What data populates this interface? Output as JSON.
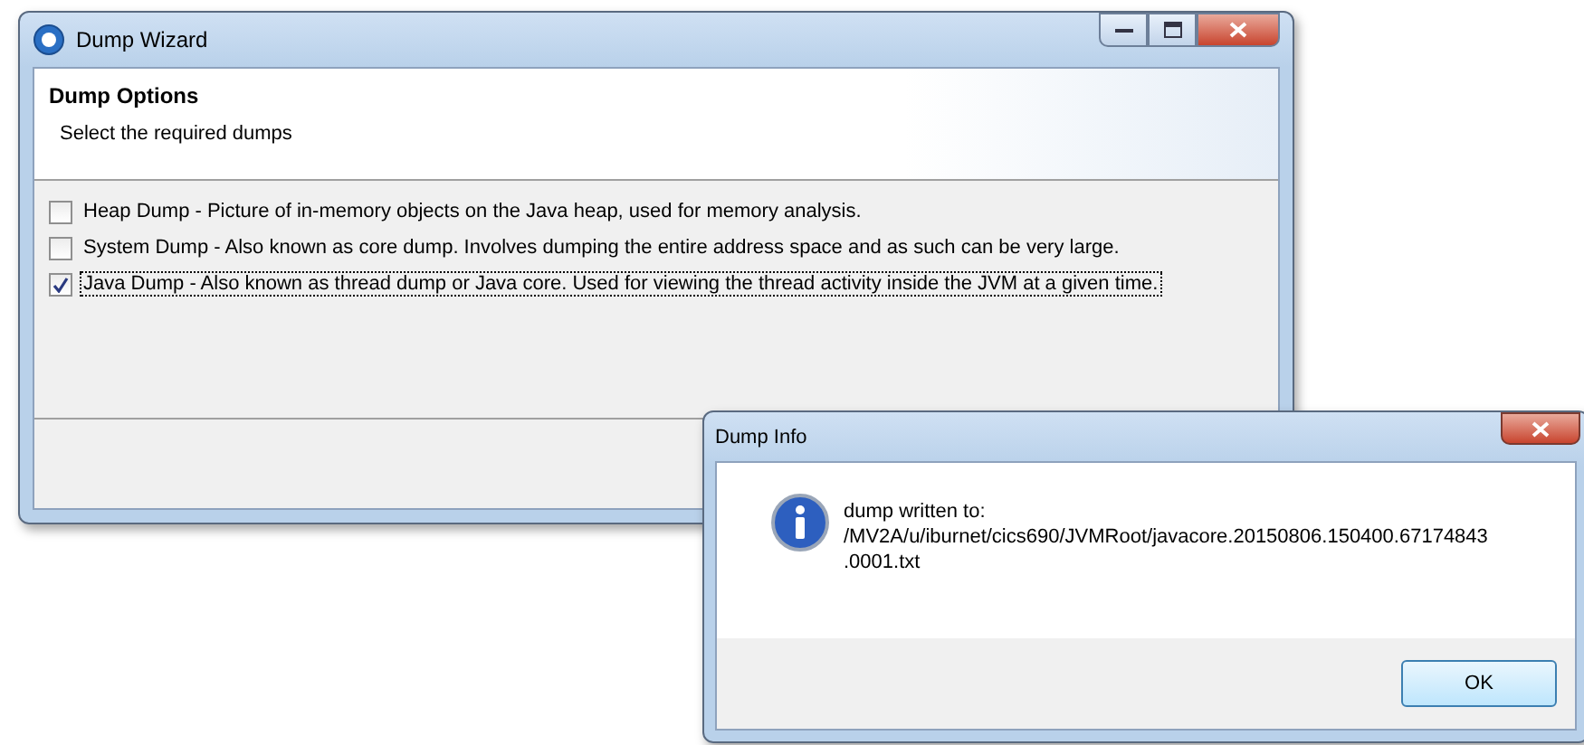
{
  "wizard": {
    "title": "Dump Wizard",
    "heading": "Dump Options",
    "subtitle": "Select the required dumps",
    "options": [
      {
        "label": "Heap Dump - Picture of in-memory objects on the Java heap, used for memory analysis.",
        "checked": false,
        "focused": false
      },
      {
        "label": "System Dump - Also known as core dump.  Involves dumping the entire address space and as such can be very large.",
        "checked": false,
        "focused": false
      },
      {
        "label": "Java Dump - Also known as thread dump or Java core. Used for viewing the thread activity inside the JVM at a given time.",
        "checked": true,
        "focused": true
      }
    ]
  },
  "dialog": {
    "title": "Dump Info",
    "message_lines": [
      "dump written to:",
      "/MV2A/u/iburnet/cics690/JVMRoot/javacore.20150806.150400.67174843",
      ".0001.txt"
    ],
    "buttons": [
      "OK"
    ]
  }
}
